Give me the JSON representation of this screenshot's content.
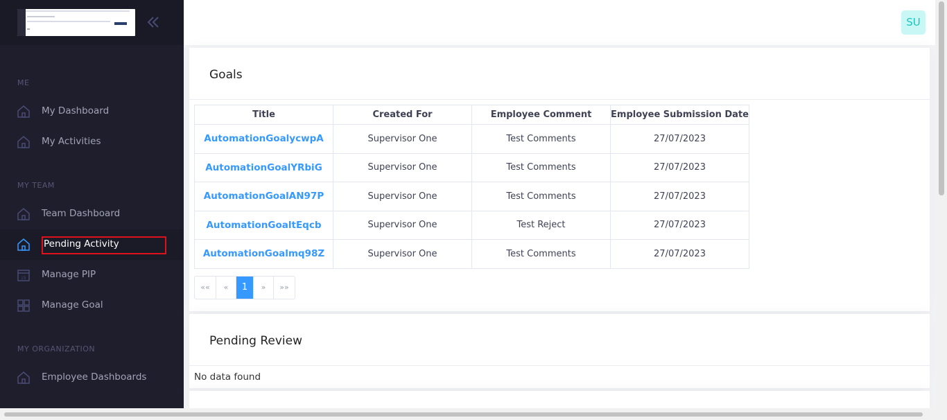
{
  "sidebar": {
    "sections": {
      "me": "ME",
      "my_team": "MY TEAM",
      "my_organization": "MY ORGANIZATION"
    },
    "items": [
      {
        "label": "My Dashboard",
        "icon": "home-icon"
      },
      {
        "label": "My Activities",
        "icon": "home-icon"
      },
      {
        "label": "Team Dashboard",
        "icon": "home-icon"
      },
      {
        "label": "Pending Activity",
        "icon": "home-icon",
        "active": true
      },
      {
        "label": "Manage PIP",
        "icon": "calendar-icon"
      },
      {
        "label": "Manage Goal",
        "icon": "grid-icon"
      },
      {
        "label": "Employee Dashboards",
        "icon": "home-icon"
      }
    ]
  },
  "header": {
    "avatar_initials": "SU"
  },
  "goals": {
    "title": "Goals",
    "columns": [
      "Title",
      "Created For",
      "Employee Comment",
      "Employee Submission Date"
    ],
    "rows": [
      [
        "AutomationGoalycwpA",
        "Supervisor One",
        "Test Comments",
        "27/07/2023"
      ],
      [
        "AutomationGoalYRbiG",
        "Supervisor One",
        "Test Comments",
        "27/07/2023"
      ],
      [
        "AutomationGoalAN97P",
        "Supervisor One",
        "Test Comments",
        "27/07/2023"
      ],
      [
        "AutomationGoaltEqcb",
        "Supervisor One",
        "Test Reject",
        "27/07/2023"
      ],
      [
        "AutomationGoalmq98Z",
        "Supervisor One",
        "Test Comments",
        "27/07/2023"
      ]
    ],
    "pagination": {
      "first": "««",
      "prev": "«",
      "current": "1",
      "next": "»",
      "last": "»»"
    }
  },
  "pending_review": {
    "title": "Pending Review",
    "empty_text": "No data found"
  },
  "colors": {
    "sidebar_bg": "#1e1e2d",
    "accent": "#3699ff",
    "highlight": "#e0101c",
    "avatar_bg": "#c9f7f5",
    "avatar_text": "#1bc5bd"
  }
}
